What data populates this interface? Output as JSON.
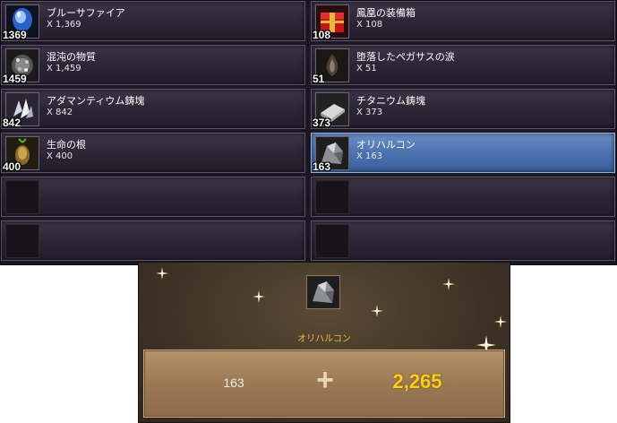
{
  "inventory": {
    "left": [
      {
        "name": "ブルーサファイア",
        "qty": "X 1,369",
        "count": "1369",
        "icon": "blue-sapphire-icon"
      },
      {
        "name": "混沌の物質",
        "qty": "X 1,459",
        "count": "1459",
        "icon": "chaos-matter-icon"
      },
      {
        "name": "アダマンティウム鋳塊",
        "qty": "X 842",
        "count": "842",
        "icon": "adamantium-ingot-icon"
      },
      {
        "name": "生命の根",
        "qty": "X 400",
        "count": "400",
        "icon": "root-of-life-icon"
      }
    ],
    "right": [
      {
        "name": "鳳凰の装備箱",
        "qty": "X 108",
        "count": "108",
        "icon": "phoenix-equipment-box-icon"
      },
      {
        "name": "堕落したペガサスの涙",
        "qty": "X 51",
        "count": "51",
        "icon": "pegasus-tear-icon"
      },
      {
        "name": "チタニウム鋳塊",
        "qty": "X 373",
        "count": "373",
        "icon": "titanium-ingot-icon"
      },
      {
        "name": "オリハルコン",
        "qty": "X 163",
        "count": "163",
        "icon": "orichalcum-icon"
      }
    ]
  },
  "exchange": {
    "item_name": "オリハルコン",
    "current": "163",
    "plus": "+",
    "total": "2,265",
    "icon": "orichalcum-icon"
  },
  "colors": {
    "selected_slot": "#4f74b2",
    "gold_text": "#ffcc1a",
    "item_label": "#f0c23b"
  }
}
